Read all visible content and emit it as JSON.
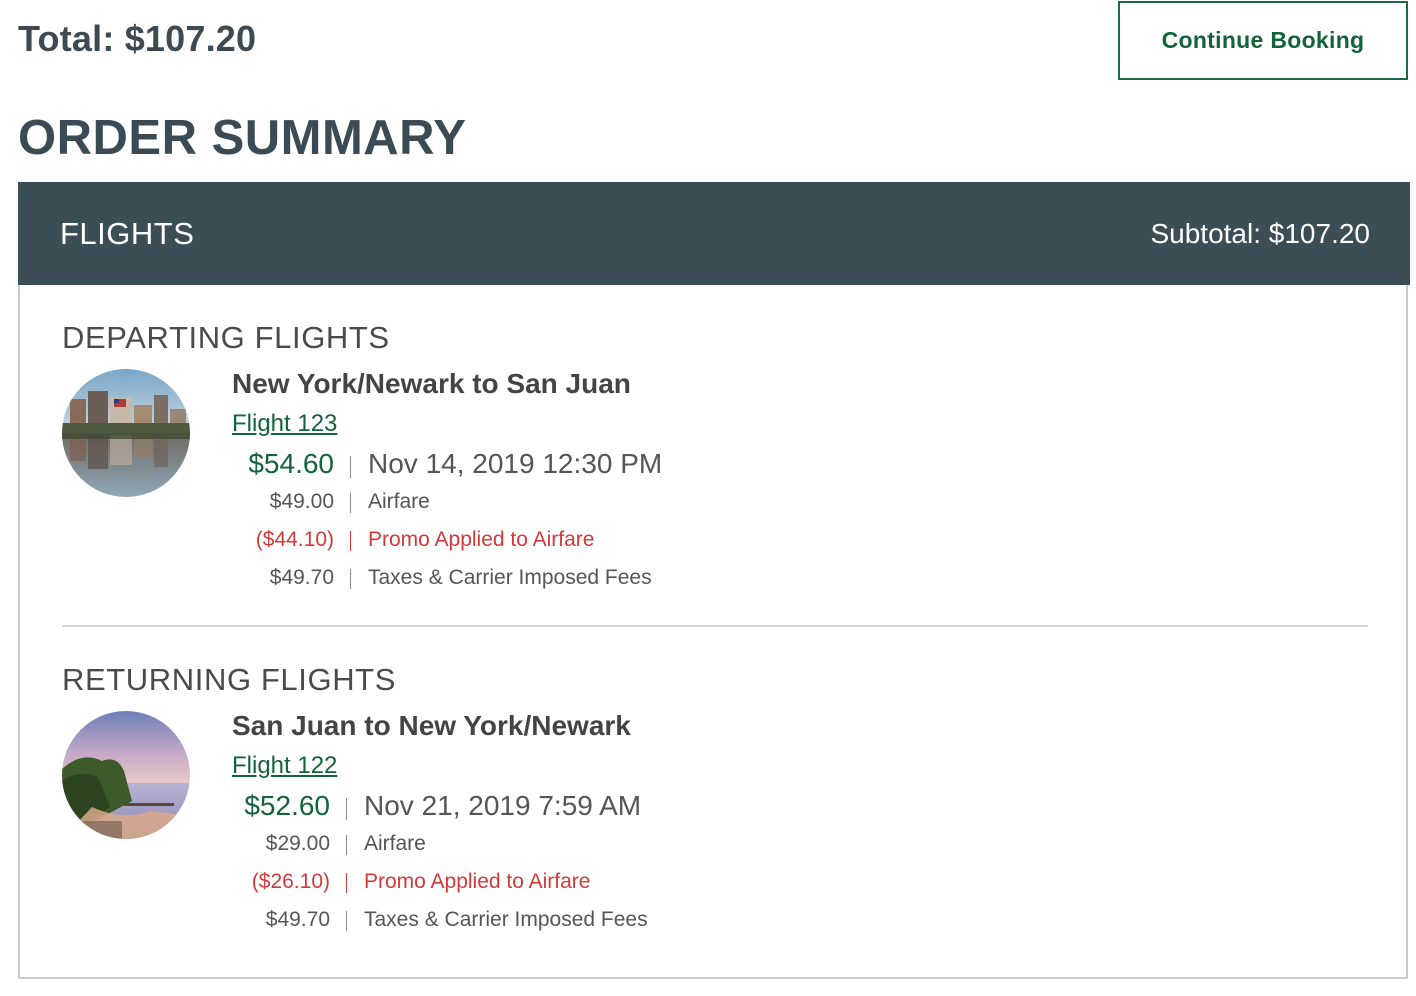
{
  "header": {
    "total": "Total: $107.20",
    "continue_label": "Continue Booking"
  },
  "order": {
    "title": "ORDER SUMMARY"
  },
  "panel": {
    "title": "FLIGHTS",
    "subtotal": "Subtotal: $107.20"
  },
  "departing": {
    "label": "DEPARTING FLIGHTS",
    "route": "New York/Newark to San Juan",
    "flight_link": "Flight 123",
    "price": "$54.60",
    "datetime": "Nov 14, 2019 12:30 PM",
    "items": [
      {
        "amount": "$49.00",
        "desc": "Airfare"
      },
      {
        "amount": "($44.10)",
        "desc": "Promo Applied to Airfare"
      },
      {
        "amount": "$49.70",
        "desc": "Taxes & Carrier Imposed Fees"
      }
    ]
  },
  "returning": {
    "label": "RETURNING FLIGHTS",
    "route": "San Juan to New York/Newark",
    "flight_link": "Flight 122",
    "price": "$52.60",
    "datetime": "Nov 21, 2019 7:59 AM",
    "items": [
      {
        "amount": "$29.00",
        "desc": "Airfare"
      },
      {
        "amount": "($26.10)",
        "desc": "Promo Applied to Airfare"
      },
      {
        "amount": "$49.70",
        "desc": "Taxes & Carrier Imposed Fees"
      }
    ]
  },
  "colors": {
    "accent_green": "#13633b",
    "header_bg": "#3b4d55",
    "promo_red": "#d23a3a"
  }
}
